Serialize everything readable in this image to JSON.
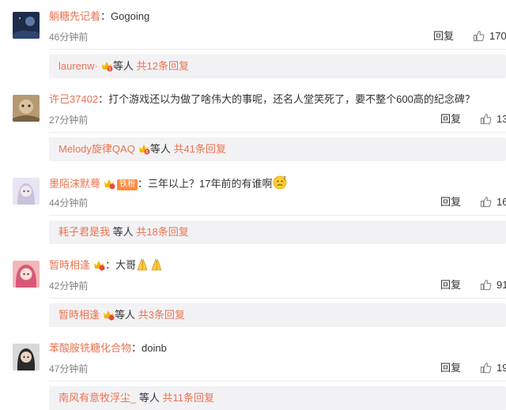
{
  "comments": [
    {
      "username": "躺糖先记着",
      "colon": "：",
      "text": "Gogoing",
      "time": "46分钟前",
      "reply_label": "回复",
      "likes": "170",
      "has_badge": false,
      "sub": {
        "name": "laurenw·",
        "suffix": "等人",
        "total": "共12条回复",
        "badge": true
      }
    },
    {
      "username": "许己37402",
      "colon": "：",
      "text": "打个游戏还以为做了啥伟大的事呢，还名人堂笑死了，要不整个600高的纪念碑？",
      "time": "27分钟前",
      "reply_label": "回复",
      "likes": "13",
      "has_badge": false,
      "sub": {
        "name": "Melody旋律QAQ",
        "suffix": "等人",
        "total": "共41条回复",
        "badge": true
      }
    },
    {
      "username": "墨陌沫默蓦",
      "colon": "：",
      "text": "三年以上？17年前的有谁啊",
      "fan_badge": "铁粉",
      "time": "44分钟前",
      "reply_label": "回复",
      "likes": "16",
      "has_badge": true,
      "sub": {
        "name": "耗子君是我",
        "suffix": "等人",
        "total": "共18条回复",
        "badge": false
      }
    },
    {
      "username": "暂時相逢",
      "colon": "：",
      "text": "大哥",
      "time": "42分钟前",
      "reply_label": "回复",
      "likes": "91",
      "has_badge": true,
      "sub": {
        "name": "暂時相逢",
        "suffix": "等人",
        "total": "共3条回复",
        "badge": true
      }
    },
    {
      "username": "苯酸胺铣糖化合物",
      "colon": "：",
      "text": "doinb",
      "time": "47分钟前",
      "reply_label": "回复",
      "likes": "19",
      "has_badge": false,
      "sub": {
        "name": "南风有意牧浮尘_",
        "suffix": "等人",
        "total": "共11条回复",
        "badge": false
      }
    }
  ],
  "colors": {
    "username": "#eb7350",
    "text": "#333333",
    "time": "#808080",
    "subbox_bg": "#f2f2f5"
  },
  "icons": {
    "like": "thumbs-up-icon",
    "vip": "weibo-vip-crown-icon",
    "emoji_pray": "folded-hands-icon",
    "emoji_thinking": "thinking-face-icon"
  }
}
